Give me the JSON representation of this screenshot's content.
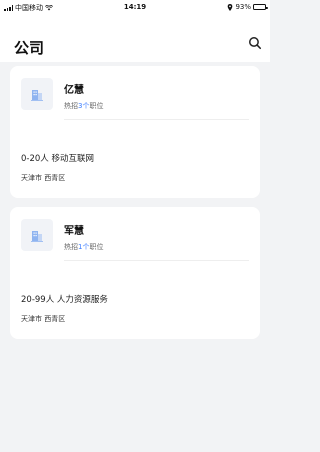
{
  "status_bar": {
    "carrier": "中国移动",
    "time": "14:19",
    "battery_percent": "93%",
    "battery_level": 0.93
  },
  "header": {
    "title": "公司"
  },
  "companies": [
    {
      "name": "亿慧",
      "jobs_prefix": "热招",
      "jobs_count": "3个",
      "jobs_suffix": "职位",
      "info": "0-20人 移动互联网",
      "location": "天津市 西青区"
    },
    {
      "name": "军慧",
      "jobs_prefix": "热招",
      "jobs_count": "1个",
      "jobs_suffix": "职位",
      "info": "20-99人 人力资源服务",
      "location": "天津市 西青区"
    }
  ],
  "colors": {
    "accent": "#3b7cff",
    "background": "#f2f3f5",
    "logo_tint": "#8fb4f0"
  }
}
